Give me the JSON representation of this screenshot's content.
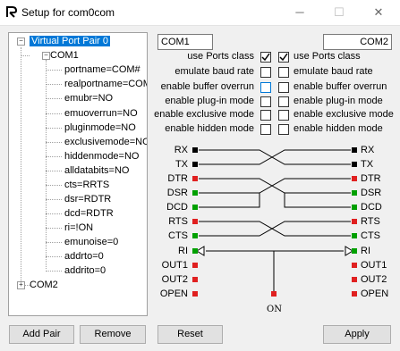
{
  "window": {
    "title": "Setup for com0com",
    "minimize_glyph": "─",
    "maximize_glyph": "☐",
    "close_glyph": "✕"
  },
  "tree": {
    "root": "Virtual Port Pair 0",
    "com1": "COM1",
    "params": [
      "portname=COM#",
      "realportname=COM",
      "emubr=NO",
      "emuoverrun=NO",
      "pluginmode=NO",
      "exclusivemode=NO",
      "hiddenmode=NO",
      "alldatabits=NO",
      "cts=RRTS",
      "dsr=RDTR",
      "dcd=RDTR",
      "ri=!ON",
      "emunoise=0",
      "addrto=0",
      "addrito=0"
    ],
    "com2": "COM2"
  },
  "ports": {
    "left_name": "COM1",
    "right_name": "COM2"
  },
  "options": [
    {
      "label": "use Ports class",
      "left": true,
      "right": true
    },
    {
      "label": "emulate baud rate",
      "left": false,
      "right": false
    },
    {
      "label": "enable buffer overrun",
      "left": false,
      "right": false
    },
    {
      "label": "enable plug-in mode",
      "left": false,
      "right": false
    },
    {
      "label": "enable exclusive mode",
      "left": false,
      "right": false
    },
    {
      "label": "enable hidden mode",
      "left": false,
      "right": false
    }
  ],
  "signals": {
    "left": [
      "RX",
      "TX",
      "DTR",
      "DSR",
      "DCD",
      "RTS",
      "CTS",
      "RI",
      "OUT1",
      "OUT2",
      "OPEN"
    ],
    "right": [
      "RX",
      "TX",
      "DTR",
      "DSR",
      "DCD",
      "RTS",
      "CTS",
      "RI",
      "OUT1",
      "OUT2",
      "OPEN"
    ],
    "on_label": "ON",
    "colors": {
      "black": "#000000",
      "red": "#e02020",
      "green": "#00a000"
    }
  },
  "buttons": {
    "add_pair": "Add Pair",
    "remove": "Remove",
    "reset": "Reset",
    "apply": "Apply"
  }
}
